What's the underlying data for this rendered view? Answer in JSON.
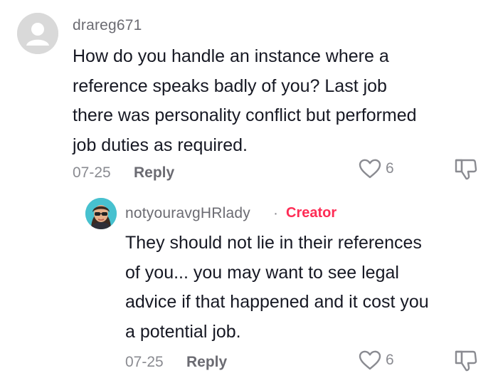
{
  "comments": [
    {
      "username": "drareg671",
      "avatar_icon": "default-avatar-icon",
      "text_lines": [
        "How do you handle an instance where a",
        "reference speaks badly of you? Last job",
        "there was personality conflict but performed",
        "job duties as required."
      ],
      "date": "07-25",
      "reply_label": "Reply",
      "like_count": "6"
    },
    {
      "username": "notyouravgHRlady",
      "avatar_icon": "profile-photo-icon",
      "separator": "·",
      "badge": "Creator",
      "text_lines": [
        "They should not lie in their references",
        "of you... you may want to see legal",
        "advice if that happened and it cost you",
        "a potential job."
      ],
      "date": "07-25",
      "reply_label": "Reply",
      "like_count": "6"
    }
  ],
  "colors": {
    "accent_creator": "#fe2c55",
    "text_primary": "#161823",
    "text_secondary": "#8a8b91"
  }
}
